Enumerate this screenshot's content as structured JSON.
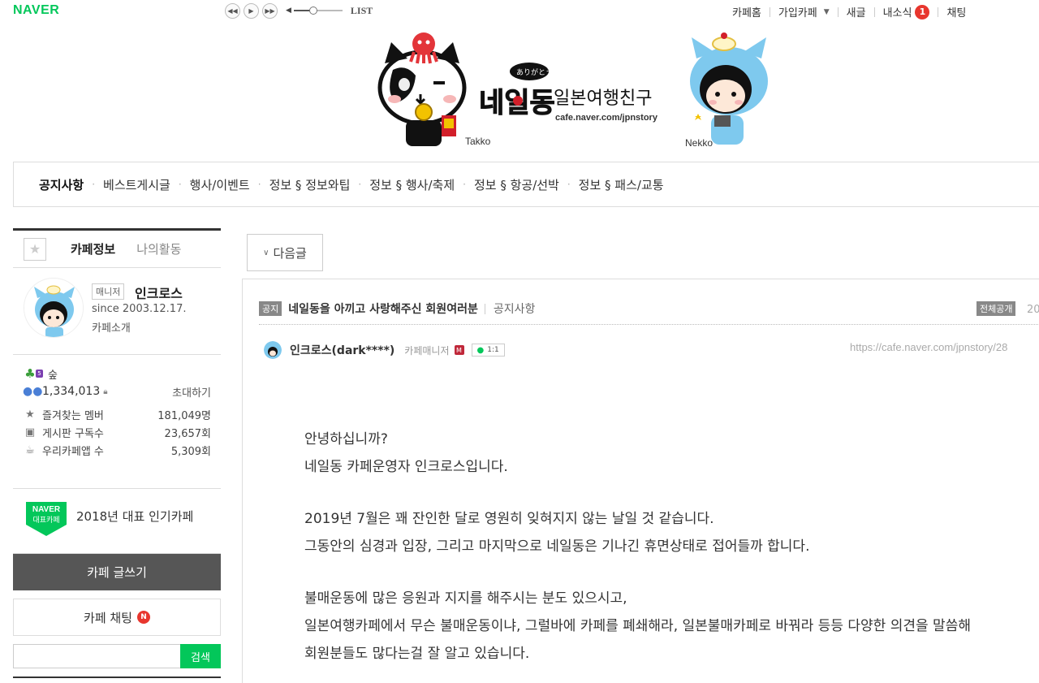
{
  "topbar": {
    "logo": "NAVER",
    "player": {
      "prev_icon": "rewind-icon",
      "play_icon": "play-icon",
      "next_icon": "fast-forward-icon",
      "volume_level": 0.4,
      "list_label": "LIST"
    },
    "links": {
      "cafe_home": "카페홈",
      "joined_cafes": "가입카페",
      "new_posts": "새글",
      "my_news": "내소식",
      "my_news_count": "1",
      "chat": "채팅"
    }
  },
  "banner": {
    "left_char_label": "Takko",
    "right_char_label": "Nekko",
    "arigatou": "ありがとう",
    "brand": "네일동",
    "title": "일본여행친구",
    "url": "cafe.naver.com/jpnstory"
  },
  "menu": {
    "items": [
      "공지사항",
      "베스트게시글",
      "행사/이벤트",
      "정보 § 정보와팁",
      "정보 § 행사/축제",
      "정보 § 항공/선박",
      "정보 § 패스/교통"
    ],
    "separator": "·"
  },
  "sidebar": {
    "tab_info": "카페정보",
    "tab_activity": "나의활동",
    "profile": {
      "role": "매니저",
      "name": "인크로스",
      "since": "since 2003.12.17.",
      "intro": "카페소개"
    },
    "grade": "숲",
    "members": "1,334,013",
    "invite": "초대하기",
    "fav_members_label": "즐겨찾는 멤버",
    "fav_members_value": "181,049명",
    "board_subs_label": "게시판 구독수",
    "board_subs_value": "23,657회",
    "app_users_label": "우리카페앱 수",
    "app_users_value": "5,309회",
    "award_badge_top": "NAVER",
    "award_badge_bottom": "대표카페",
    "award_text": "2018년 대표 인기카페",
    "write_button": "카페 글쓰기",
    "chat_button": "카페 채팅",
    "chat_badge": "N",
    "search_placeholder": "",
    "search_button": "검색"
  },
  "main": {
    "next_button": "다음글",
    "post": {
      "notice_tag": "공지",
      "title": "네일동을 아끼고 사랑해주신 회원여러분",
      "board": "공지사항",
      "public_tag": "전체공개",
      "date_partial": "20",
      "author": "인크로스(dark****)",
      "author_role": "카페매니저",
      "chat_label": "1:1",
      "url": "https://cafe.naver.com/jpnstory/28",
      "body": [
        "안녕하십니까?",
        "네일동 카페운영자 인크로스입니다.",
        "",
        "2019년 7월은 꽤 잔인한 달로 영원히 잊혀지지 않는 날일 것 같습니다.",
        "그동안의 심경과 입장, 그리고 마지막으로 네일동은 기나긴 휴면상태로 접어들까 합니다.",
        "",
        "불매운동에 많은 응원과 지지를 해주시는 분도 있으시고,",
        "일본여행카페에서 무슨 불매운동이냐, 그럴바에 카페를 폐쇄해라, 일본불매카페로 바꿔라 등등 다양한 의견을 말씀해",
        "회원분들도 많다는걸 잘 알고 있습니다."
      ]
    }
  },
  "colors": {
    "naver_green": "#03c75a",
    "badge_red": "#e8362e",
    "write_button_bg": "#565656",
    "tag_gray": "#888888"
  }
}
